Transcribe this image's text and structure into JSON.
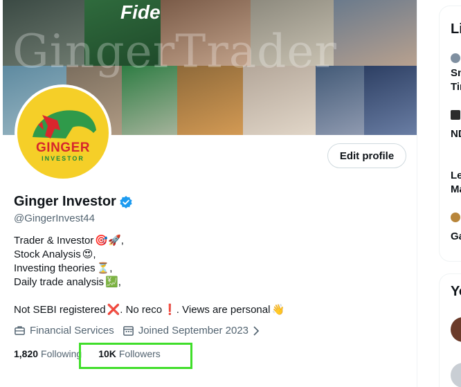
{
  "banner": {
    "watermark": "GingerTrader",
    "brand_text": "Fide"
  },
  "avatar": {
    "word": "GINGER",
    "sub": "INVESTOR"
  },
  "actions": {
    "edit_profile": "Edit profile"
  },
  "profile": {
    "name": "Ginger Investor",
    "handle": "@GingerInvest44",
    "bio": {
      "line1": "Trader & Investor",
      "line1_emoji": "🎯🚀",
      "line1_suffix": ",",
      "line2": "Stock Analysis",
      "line2_emoji": "😍",
      "line2_suffix": ",",
      "line3": "Investing theories",
      "line3_emoji": "⏳",
      "line3_suffix": ",",
      "line4": "Daily trade analysis",
      "line4_emoji": "💹",
      "line4_suffix": ",",
      "line5_a": "Not SEBI registered",
      "line5_emoji1": "❌",
      "line5_b": ". No reco",
      "line5_emoji2": "❗",
      "line5_c": ". Views are personal",
      "line5_emoji3": "👋"
    },
    "category": "Financial Services",
    "joined": "Joined September 2023",
    "following_count": "1,820",
    "following_label": "Following",
    "followers_count": "10K",
    "followers_label": "Followers"
  },
  "sidebar": {
    "card1_title": "Li",
    "item1_line1": "Sn",
    "item1_line2": "Tir",
    "item2": "ND",
    "item3_line1": "Le",
    "item3_line2": "Ma",
    "item4": "Ga",
    "card2_title": "Yo"
  },
  "colors": {
    "accent": "#1d9bf0",
    "highlight": "#3fde29",
    "secondary_text": "#536471"
  }
}
